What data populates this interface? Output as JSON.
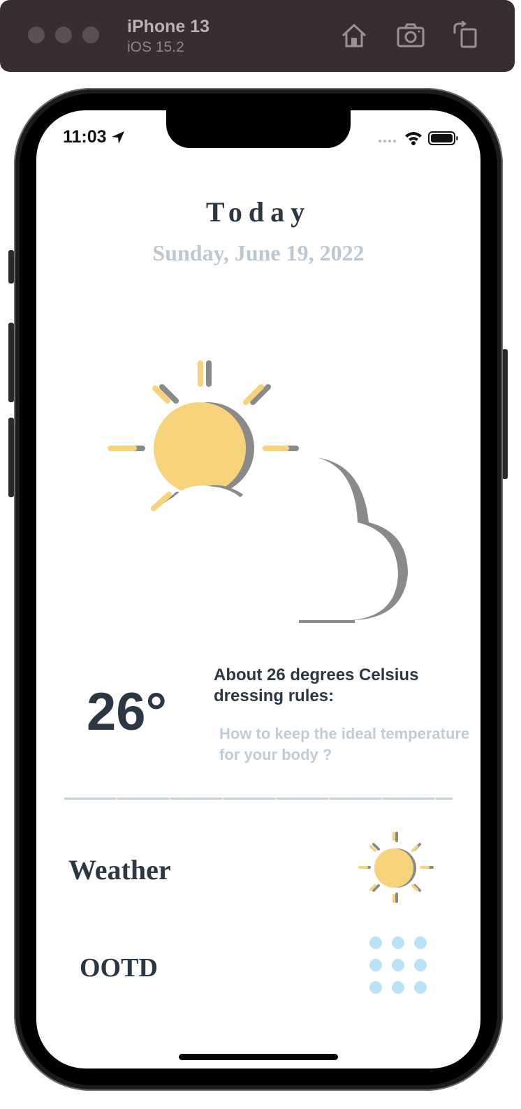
{
  "simulator": {
    "device_name": "iPhone 13",
    "os_version": "iOS 15.2",
    "icons": [
      "home-icon",
      "screenshot-icon",
      "rotate-icon"
    ]
  },
  "status_bar": {
    "time": "11:03"
  },
  "header": {
    "title": "Today",
    "date": "Sunday, June 19, 2022"
  },
  "current": {
    "temperature": "26°",
    "rules_title": "About 26 degrees Celsius dressing rules:",
    "question": "How to keep the ideal temperature for your body ?"
  },
  "menu": {
    "weather_label": "Weather",
    "ootd_label": "OOTD"
  },
  "colors": {
    "sun": "#f7d47b",
    "text_dark": "#2b3844",
    "text_light": "#bcc7d0",
    "dots": "#b8e2f8",
    "shadow": "#8a8a8a"
  }
}
